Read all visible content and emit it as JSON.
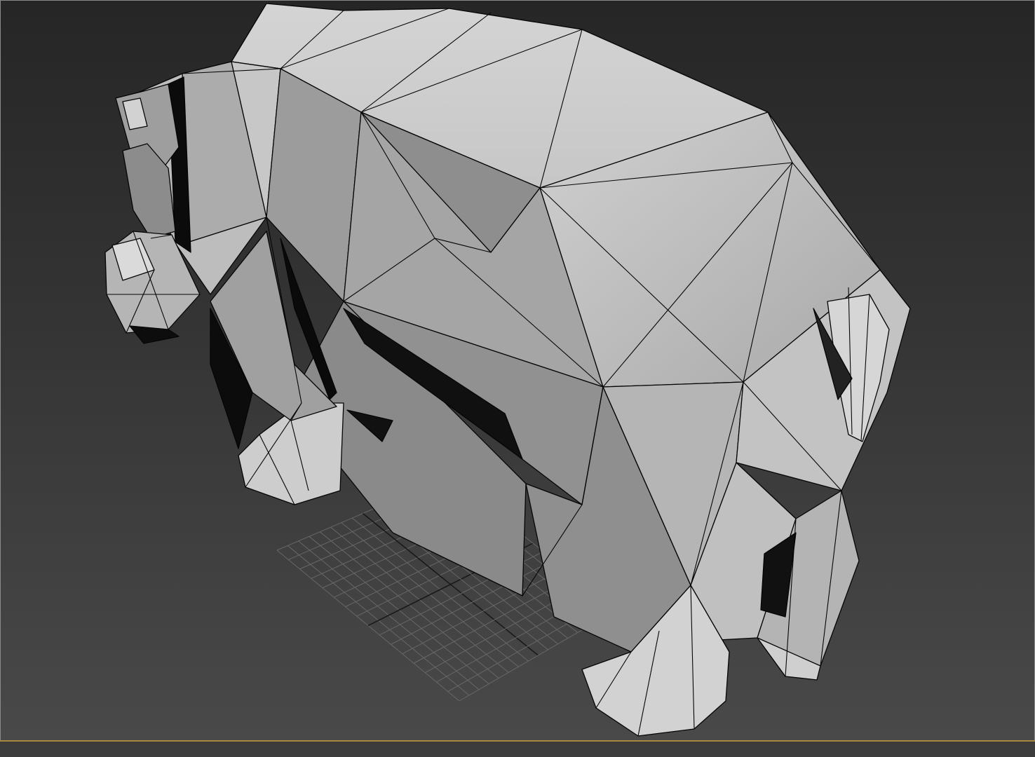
{
  "viewport": {
    "view_mode": "perspective",
    "shading": "shaded-with-edged-faces",
    "background_color": "#333333",
    "grid_color": "#6e6e6e",
    "edge_color": "#000000",
    "active_border_color": "#a8893f",
    "object": "low-poly-hippo-model"
  }
}
